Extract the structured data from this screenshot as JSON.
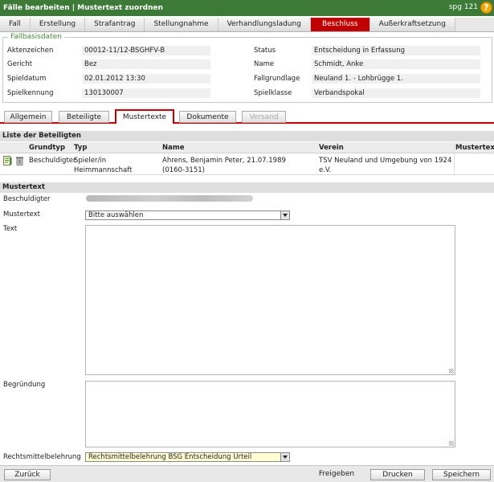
{
  "window": {
    "title": "Fälle bearbeiten | Mustertext zuordnen",
    "user": "spg 121",
    "help_icon": "?"
  },
  "main_tabs": [
    {
      "label": "Fall"
    },
    {
      "label": "Erstellung"
    },
    {
      "label": "Strafantrag"
    },
    {
      "label": "Stellungnahme"
    },
    {
      "label": "Verhandlungsladung"
    },
    {
      "label": "Beschluss"
    },
    {
      "label": "Außerkraftsetzung"
    }
  ],
  "active_main_tab": "Beschluss",
  "fallbasisdaten": {
    "legend": "Fallbasisdaten",
    "left": [
      {
        "label": "Aktenzeichen",
        "value": "00012-11/12-BSGHFV-B"
      },
      {
        "label": "Gericht",
        "value": "Bez"
      },
      {
        "label": "Spieldatum",
        "value": "02.01.2012 13:30"
      },
      {
        "label": "Spielkennung",
        "value": "130130007"
      }
    ],
    "right": [
      {
        "label": "Status",
        "value": "Entscheidung in Erfassung"
      },
      {
        "label": "Name",
        "value": "Schmidt, Anke"
      },
      {
        "label": "Fallgrundlage",
        "value": "Neuland 1. - Lohbrügge 1."
      },
      {
        "label": "Spielklasse",
        "value": "Verbandspokal"
      }
    ]
  },
  "sub_tabs": [
    {
      "label": "Allgemein"
    },
    {
      "label": "Beteiligte"
    },
    {
      "label": "Mustertexte"
    },
    {
      "label": "Dokumente"
    },
    {
      "label": "Versand"
    }
  ],
  "beteiligte": {
    "title": "Liste der Beteiligten",
    "columns": [
      "Grundtyp",
      "Typ",
      "Name",
      "Verein",
      "Mustertext"
    ],
    "rows": [
      {
        "grundtyp": "Beschuldigter",
        "typ_line1": "Spieler/in",
        "typ_line2": "Heimmannschaft",
        "name_line1": "Ahrens, Benjamin Peter, 21.07.1989",
        "name_line2": "(0160-3151)",
        "verein_line1": "TSV Neuland und Umgebung von 1924",
        "verein_line2": "e.V.",
        "mustertext": "",
        "icons": [
          "edit-icon",
          "delete-icon"
        ]
      }
    ]
  },
  "mustertext_form": {
    "title": "Mustertext",
    "beschuldigter_label": "Beschuldigter",
    "mustertext_label": "Mustertext",
    "mustertext_value": "Bitte auswählen",
    "text_label": "Text",
    "text_value": "",
    "begruendung_label": "Begründung",
    "begruendung_value": "",
    "rechtsmittel_label": "Rechtsmittelbelehrung",
    "rechtsmittel_value": "Rechtsmittelbelehrung BSG Entscheidung Urteil"
  },
  "footer": {
    "back": "Zurück",
    "release": "Freigeben",
    "print": "Drucken",
    "save": "Speichern"
  }
}
